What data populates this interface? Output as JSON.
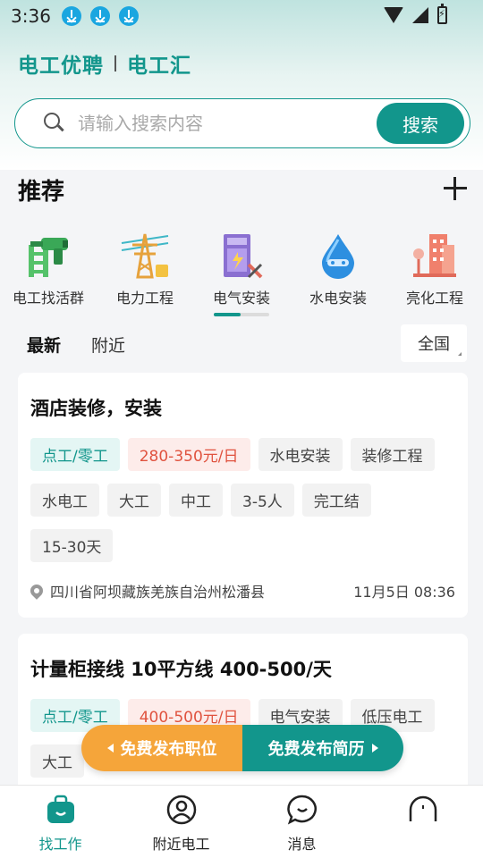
{
  "status_bar": {
    "time": "3:36"
  },
  "brand": {
    "primary": "电工优聘",
    "secondary": "电工汇"
  },
  "search": {
    "placeholder": "请输入搜索内容",
    "button_label": "搜索"
  },
  "recommend": {
    "title": "推荐"
  },
  "categories": [
    {
      "label": "电工找活群",
      "icon": "drill-ladder-icon"
    },
    {
      "label": "电力工程",
      "icon": "power-tower-icon"
    },
    {
      "label": "电气安装",
      "icon": "electrical-cabinet-icon",
      "active": true
    },
    {
      "label": "水电安装",
      "icon": "water-drop-icon"
    },
    {
      "label": "亮化工程",
      "icon": "city-lighting-icon"
    }
  ],
  "sub_tabs": [
    {
      "label": "最新",
      "active": true
    },
    {
      "label": "附近",
      "active": false
    }
  ],
  "region": "全国",
  "jobs": [
    {
      "title": "酒店装修，安装",
      "type_tag": "点工/零工",
      "pay_tag": "280-350元/日",
      "tags": [
        "水电安装",
        "装修工程",
        "水电工",
        "大工",
        "中工",
        "3-5人",
        "完工结",
        "15-30天"
      ],
      "location": "四川省阿坝藏族羌族自治州松潘县",
      "time": "11月5日 08:36"
    },
    {
      "title": "计量柜接线 10平方线 400-500/天",
      "type_tag": "点工/零工",
      "pay_tag": "400-500元/日",
      "tags": [
        "电气安装",
        "低压电工",
        "大工"
      ]
    }
  ],
  "float_actions": {
    "post_job": "免费发布职位",
    "post_resume": "免费发布简历"
  },
  "bottom_nav": [
    {
      "label": "找工作",
      "icon": "briefcase-icon",
      "active": true
    },
    {
      "label": "附近电工",
      "icon": "user-circle-icon",
      "active": false
    },
    {
      "label": "消息",
      "icon": "chat-bubble-icon",
      "active": false
    },
    {
      "label": "",
      "icon": "profile-icon",
      "active": false
    }
  ],
  "colors": {
    "accent": "#12968c",
    "orange": "#f5a53a",
    "pay_red": "#e0533f"
  }
}
